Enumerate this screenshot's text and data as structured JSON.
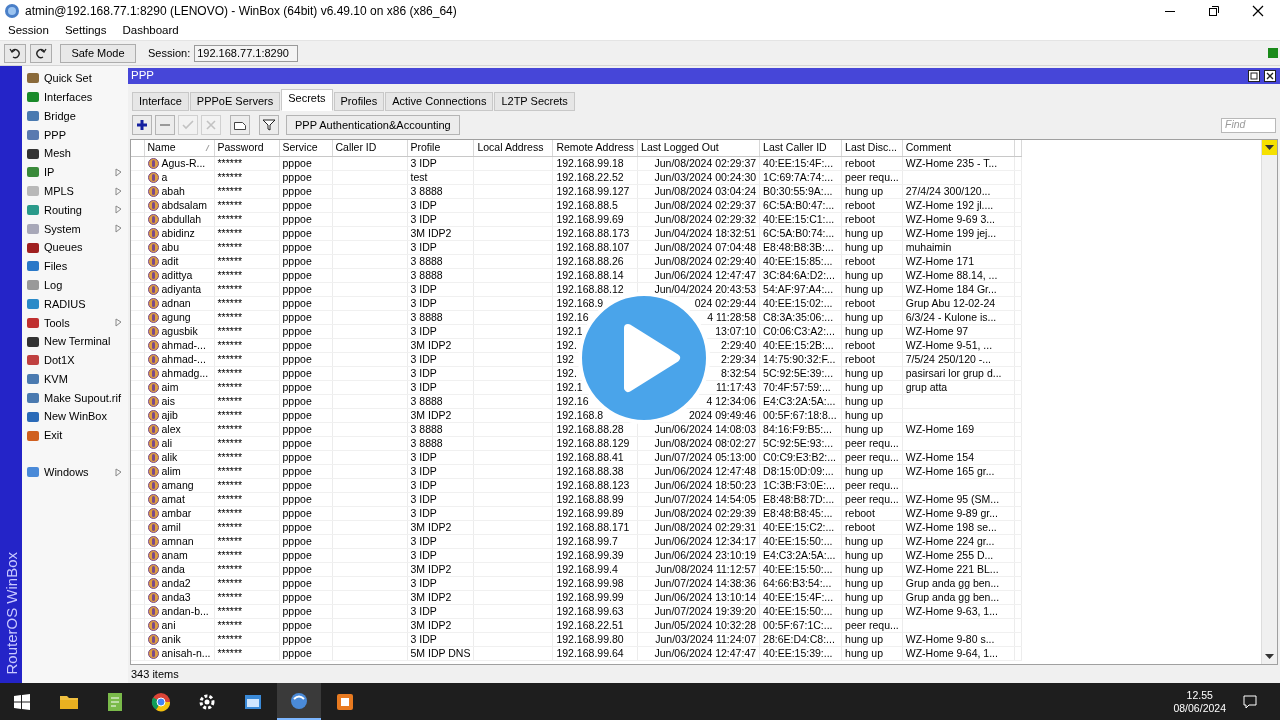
{
  "window": {
    "title": "atmin@192.168.77.1:8290 (LENOVO) - WinBox (64bit) v6.49.10 on x86 (x86_64)"
  },
  "menu": [
    "Session",
    "Settings",
    "Dashboard"
  ],
  "toolbar": {
    "safe_mode": "Safe Mode",
    "session_label": "Session:",
    "session_value": "192.168.77.1:8290"
  },
  "side_label": "RouterOS WinBox",
  "sidebar": {
    "items": [
      {
        "label": "Quick Set",
        "submenu": false
      },
      {
        "label": "Interfaces",
        "submenu": false
      },
      {
        "label": "Bridge",
        "submenu": false
      },
      {
        "label": "PPP",
        "submenu": false
      },
      {
        "label": "Mesh",
        "submenu": false
      },
      {
        "label": "IP",
        "submenu": true
      },
      {
        "label": "MPLS",
        "submenu": true
      },
      {
        "label": "Routing",
        "submenu": true
      },
      {
        "label": "System",
        "submenu": true
      },
      {
        "label": "Queues",
        "submenu": false
      },
      {
        "label": "Files",
        "submenu": false
      },
      {
        "label": "Log",
        "submenu": false
      },
      {
        "label": "RADIUS",
        "submenu": false
      },
      {
        "label": "Tools",
        "submenu": true
      },
      {
        "label": "New Terminal",
        "submenu": false
      },
      {
        "label": "Dot1X",
        "submenu": false
      },
      {
        "label": "KVM",
        "submenu": false
      },
      {
        "label": "Make Supout.rif",
        "submenu": false
      },
      {
        "label": "New WinBox",
        "submenu": false
      },
      {
        "label": "Exit",
        "submenu": false
      }
    ],
    "bottom_items": [
      {
        "label": "Windows",
        "submenu": true
      }
    ]
  },
  "ppp_window": {
    "title": "PPP",
    "tabs": [
      {
        "label": "Interface",
        "selected": false
      },
      {
        "label": "PPPoE Servers",
        "selected": false
      },
      {
        "label": "Secrets",
        "selected": true
      },
      {
        "label": "Profiles",
        "selected": false
      },
      {
        "label": "Active Connections",
        "selected": false
      },
      {
        "label": "L2TP Secrets",
        "selected": false
      }
    ],
    "tool_buttons": [
      {
        "kind": "add",
        "disabled": false
      },
      {
        "kind": "remove",
        "disabled": false
      },
      {
        "kind": "enable",
        "disabled": true
      },
      {
        "kind": "disable",
        "disabled": true
      },
      {
        "kind": "comment",
        "disabled": false
      },
      {
        "kind": "filter",
        "disabled": false
      }
    ],
    "auth_button": "PPP Authentication&Accounting",
    "find": {
      "placeholder": "Find"
    },
    "table": {
      "columns": [
        "Name",
        "Password",
        "Service",
        "Caller ID",
        "Profile",
        "Local Address",
        "Remote Address",
        "Last Logged Out",
        "Last Caller ID",
        "Last Disc...",
        "Comment"
      ],
      "rows": [
        {
          "name": "Agus-R...",
          "password": "******",
          "service": "pppoe",
          "profile": "3 IDP",
          "remote_address": "192.168.99.18",
          "last_logged_out": "Jun/08/2024 02:29:37",
          "last_caller_id": "40:EE:15:4F:...",
          "last_disconnect": "reboot",
          "comment": "WZ-Home 235 - T..."
        },
        {
          "name": "a",
          "password": "******",
          "service": "pppoe",
          "profile": "test",
          "remote_address": "192.168.22.52",
          "last_logged_out": "Jun/03/2024 00:24:30",
          "last_caller_id": "1C:69:7A:74:...",
          "last_disconnect": "peer requ..."
        },
        {
          "name": "abah",
          "password": "******",
          "service": "pppoe",
          "profile": "3 8888",
          "remote_address": "192.168.99.127",
          "last_logged_out": "Jun/08/2024 03:04:24",
          "last_caller_id": "B0:30:55:9A:...",
          "last_disconnect": "hung up",
          "comment": "27/4/24 300/120..."
        },
        {
          "name": "abdsalam",
          "password": "******",
          "service": "pppoe",
          "profile": "3 IDP",
          "remote_address": "192.168.88.5",
          "last_logged_out": "Jun/08/2024 02:29:37",
          "last_caller_id": "6C:5A:B0:47:...",
          "last_disconnect": "reboot",
          "comment": "WZ-Home 192 jl...."
        },
        {
          "name": "abdullah",
          "password": "******",
          "service": "pppoe",
          "profile": "3 IDP",
          "remote_address": "192.168.99.69",
          "last_logged_out": "Jun/08/2024 02:29:32",
          "last_caller_id": "40:EE:15:C1:...",
          "last_disconnect": "reboot",
          "comment": "WZ-Home 9-69 3..."
        },
        {
          "name": "abidinz",
          "password": "******",
          "service": "pppoe",
          "profile": "3M IDP2",
          "remote_address": "192.168.88.173",
          "last_logged_out": "Jun/04/2024 18:32:51",
          "last_caller_id": "6C:5A:B0:74:...",
          "last_disconnect": "hung up",
          "comment": "WZ-Home 199 jej..."
        },
        {
          "name": "abu",
          "password": "******",
          "service": "pppoe",
          "profile": "3 IDP",
          "remote_address": "192.168.88.107",
          "last_logged_out": "Jun/08/2024 07:04:48",
          "last_caller_id": "E8:48:B8:3B:...",
          "last_disconnect": "hung up",
          "comment": "muhaimin"
        },
        {
          "name": "adit",
          "password": "******",
          "service": "pppoe",
          "profile": "3 8888",
          "remote_address": "192.168.88.26",
          "last_logged_out": "Jun/08/2024 02:29:40",
          "last_caller_id": "40:EE:15:85:...",
          "last_disconnect": "reboot",
          "comment": "WZ-Home 171"
        },
        {
          "name": "adittya",
          "password": "******",
          "service": "pppoe",
          "profile": "3 8888",
          "remote_address": "192.168.88.14",
          "last_logged_out": "Jun/06/2024 12:47:47",
          "last_caller_id": "3C:84:6A:D2:...",
          "last_disconnect": "hung up",
          "comment": "WZ-Home 88.14, ..."
        },
        {
          "name": "adiyanta",
          "password": "******",
          "service": "pppoe",
          "profile": "3 IDP",
          "remote_address": "192.168.88.12",
          "last_logged_out": "Jun/04/2024 20:43:53",
          "last_caller_id": "54:AF:97:A4:...",
          "last_disconnect": "hung up",
          "comment": "WZ-Home 184 Gr..."
        },
        {
          "name": "adnan",
          "password": "******",
          "service": "pppoe",
          "profile": "3 IDP",
          "remote_address": "192.168.9",
          "last_logged_out": "024 02:29:44",
          "last_caller_id": "40:EE:15:02:...",
          "last_disconnect": "reboot",
          "comment": "Grup Abu 12-02-24"
        },
        {
          "name": "agung",
          "password": "******",
          "service": "pppoe",
          "profile": "3 8888",
          "remote_address": "192.16",
          "last_logged_out": "4 11:28:58",
          "last_caller_id": "C8:3A:35:06:...",
          "last_disconnect": "hung up",
          "comment": "6/3/24 - Kulone is..."
        },
        {
          "name": "agusbik",
          "password": "******",
          "service": "pppoe",
          "profile": "3 IDP",
          "remote_address": "192.1",
          "last_logged_out": "13:07:10",
          "last_caller_id": "C0:06:C3:A2:...",
          "last_disconnect": "hung up",
          "comment": "WZ-Home 97"
        },
        {
          "name": "ahmad-...",
          "password": "******",
          "service": "pppoe",
          "profile": "3M IDP2",
          "remote_address": "192.",
          "last_logged_out": "2:29:40",
          "last_caller_id": "40:EE:15:2B:...",
          "last_disconnect": "reboot",
          "comment": "WZ-Home 9-51, ..."
        },
        {
          "name": "ahmad-...",
          "password": "******",
          "service": "pppoe",
          "profile": "3 IDP",
          "remote_address": "192",
          "last_logged_out": "2:29:34",
          "last_caller_id": "14:75:90:32:F...",
          "last_disconnect": "reboot",
          "comment": "7/5/24 250/120 -..."
        },
        {
          "name": "ahmadg...",
          "password": "******",
          "service": "pppoe",
          "profile": "3 IDP",
          "remote_address": "192.",
          "last_logged_out": "8:32:54",
          "last_caller_id": "5C:92:5E:39:...",
          "last_disconnect": "hung up",
          "comment": "pasirsari lor grup d..."
        },
        {
          "name": "aim",
          "password": "******",
          "service": "pppoe",
          "profile": "3 IDP",
          "remote_address": "192.1",
          "last_logged_out": "11:17:43",
          "last_caller_id": "70:4F:57:59:...",
          "last_disconnect": "hung up",
          "comment": "grup atta"
        },
        {
          "name": "ais",
          "password": "******",
          "service": "pppoe",
          "profile": "3 8888",
          "remote_address": "192.16",
          "last_logged_out": "4 12:34:06",
          "last_caller_id": "E4:C3:2A:5A:...",
          "last_disconnect": "hung up"
        },
        {
          "name": "ajib",
          "password": "******",
          "service": "pppoe",
          "profile": "3M IDP2",
          "remote_address": "192.168.8",
          "last_logged_out": "2024 09:49:46",
          "last_caller_id": "00:5F:67:18:8...",
          "last_disconnect": "hung up"
        },
        {
          "name": "alex",
          "password": "******",
          "service": "pppoe",
          "profile": "3 8888",
          "remote_address": "192.168.88.28",
          "last_logged_out": "Jun/06/2024 14:08:03",
          "last_caller_id": "84:16:F9:B5:...",
          "last_disconnect": "hung up",
          "comment": "WZ-Home 169"
        },
        {
          "name": "ali",
          "password": "******",
          "service": "pppoe",
          "profile": "3 8888",
          "remote_address": "192.168.88.129",
          "last_logged_out": "Jun/08/2024 08:02:27",
          "last_caller_id": "5C:92:5E:93:...",
          "last_disconnect": "peer requ..."
        },
        {
          "name": "alik",
          "password": "******",
          "service": "pppoe",
          "profile": "3 IDP",
          "remote_address": "192.168.88.41",
          "last_logged_out": "Jun/07/2024 05:13:00",
          "last_caller_id": "C0:C9:E3:B2:...",
          "last_disconnect": "peer requ...",
          "comment": "WZ-Home 154"
        },
        {
          "name": "alim",
          "password": "******",
          "service": "pppoe",
          "profile": "3 IDP",
          "remote_address": "192.168.88.38",
          "last_logged_out": "Jun/06/2024 12:47:48",
          "last_caller_id": "D8:15:0D:09:...",
          "last_disconnect": "hung up",
          "comment": "WZ-Home 165 gr..."
        },
        {
          "name": "amang",
          "password": "******",
          "service": "pppoe",
          "profile": "3 IDP",
          "remote_address": "192.168.88.123",
          "last_logged_out": "Jun/06/2024 18:50:23",
          "last_caller_id": "1C:3B:F3:0E:...",
          "last_disconnect": "peer requ..."
        },
        {
          "name": "amat",
          "password": "******",
          "service": "pppoe",
          "profile": "3 IDP",
          "remote_address": "192.168.88.99",
          "last_logged_out": "Jun/07/2024 14:54:05",
          "last_caller_id": "E8:48:B8:7D:...",
          "last_disconnect": "peer requ...",
          "comment": "WZ-Home 95 (SM..."
        },
        {
          "name": "ambar",
          "password": "******",
          "service": "pppoe",
          "profile": "3 IDP",
          "remote_address": "192.168.99.89",
          "last_logged_out": "Jun/08/2024 02:29:39",
          "last_caller_id": "E8:48:B8:45:...",
          "last_disconnect": "reboot",
          "comment": "WZ-Home 9-89 gr..."
        },
        {
          "name": "amil",
          "password": "******",
          "service": "pppoe",
          "profile": "3M IDP2",
          "remote_address": "192.168.88.171",
          "last_logged_out": "Jun/08/2024 02:29:31",
          "last_caller_id": "40:EE:15:C2:...",
          "last_disconnect": "reboot",
          "comment": "WZ-Home 198 se..."
        },
        {
          "name": "amnan",
          "password": "******",
          "service": "pppoe",
          "profile": "3 IDP",
          "remote_address": "192.168.99.7",
          "last_logged_out": "Jun/06/2024 12:34:17",
          "last_caller_id": "40:EE:15:50:...",
          "last_disconnect": "hung up",
          "comment": "WZ-Home 224 gr..."
        },
        {
          "name": "anam",
          "password": "******",
          "service": "pppoe",
          "profile": "3 IDP",
          "remote_address": "192.168.99.39",
          "last_logged_out": "Jun/06/2024 23:10:19",
          "last_caller_id": "E4:C3:2A:5A:...",
          "last_disconnect": "hung up",
          "comment": "WZ-Home 255 D..."
        },
        {
          "name": "anda",
          "password": "******",
          "service": "pppoe",
          "profile": "3M IDP2",
          "remote_address": "192.168.99.4",
          "last_logged_out": "Jun/08/2024 11:12:57",
          "last_caller_id": "40:EE:15:50:...",
          "last_disconnect": "hung up",
          "comment": "WZ-Home 221 BL..."
        },
        {
          "name": "anda2",
          "password": "******",
          "service": "pppoe",
          "profile": "3 IDP",
          "remote_address": "192.168.99.98",
          "last_logged_out": "Jun/07/2024 14:38:36",
          "last_caller_id": "64:66:B3:54:...",
          "last_disconnect": "hung up",
          "comment": "Grup anda gg ben..."
        },
        {
          "name": "anda3",
          "password": "******",
          "service": "pppoe",
          "profile": "3M IDP2",
          "remote_address": "192.168.99.99",
          "last_logged_out": "Jun/06/2024 13:10:14",
          "last_caller_id": "40:EE:15:4F:...",
          "last_disconnect": "hung up",
          "comment": "Grup anda gg ben..."
        },
        {
          "name": "andan-b...",
          "password": "******",
          "service": "pppoe",
          "profile": "3 IDP",
          "remote_address": "192.168.99.63",
          "last_logged_out": "Jun/07/2024 19:39:20",
          "last_caller_id": "40:EE:15:50:...",
          "last_disconnect": "hung up",
          "comment": "WZ-Home 9-63, 1..."
        },
        {
          "name": "ani",
          "password": "******",
          "service": "pppoe",
          "profile": "3M IDP2",
          "remote_address": "192.168.22.51",
          "last_logged_out": "Jun/05/2024 10:32:28",
          "last_caller_id": "00:5F:67:1C:...",
          "last_disconnect": "peer requ..."
        },
        {
          "name": "anik",
          "password": "******",
          "service": "pppoe",
          "profile": "3 IDP",
          "remote_address": "192.168.99.80",
          "last_logged_out": "Jun/03/2024 11:24:07",
          "last_caller_id": "28:6E:D4:C8:...",
          "last_disconnect": "hung up",
          "comment": "WZ-Home 9-80 s..."
        },
        {
          "name": "anisah-n...",
          "password": "******",
          "service": "pppoe",
          "profile": "5M IDP DNS",
          "remote_address": "192.168.99.64",
          "last_logged_out": "Jun/06/2024 12:47:47",
          "last_caller_id": "40:EE:15:39:...",
          "last_disconnect": "hung up",
          "comment": "WZ-Home 9-64, 1..."
        }
      ]
    },
    "status": "343 items"
  },
  "taskbar": {
    "apps": [
      {
        "selected": false
      },
      {
        "selected": false
      },
      {
        "selected": false
      },
      {
        "selected": false
      },
      {
        "selected": false
      },
      {
        "selected": true
      },
      {
        "selected": false
      }
    ],
    "time": "12.55",
    "date": "08/06/2024"
  }
}
